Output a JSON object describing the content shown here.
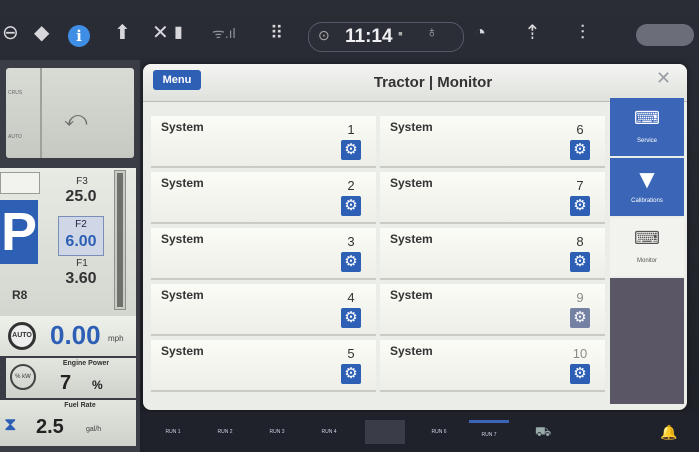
{
  "status_bar": {
    "time": "11:14",
    "info_icon": "i"
  },
  "left_panel": {
    "top_labels": [
      "CRUS",
      "AUTO"
    ],
    "gear_big": "P",
    "gears": [
      {
        "label": "F3",
        "value": "25.0"
      },
      {
        "label": "F2",
        "value": "6.00"
      },
      {
        "label": "F1",
        "value": "3.60"
      }
    ],
    "range_label": "R8",
    "auto_label": "AUTO",
    "speed_value": "0.00",
    "speed_unit": "mph",
    "engine_power_label": "Engine Power",
    "engine_power_icon_label": "% kW",
    "engine_power_value": "7",
    "engine_power_unit": "%",
    "fuel_rate_label": "Fuel Rate",
    "fuel_rate_value": "2.5",
    "fuel_rate_unit": "gal/h"
  },
  "dialog": {
    "menu_label": "Menu",
    "title": "Tractor | Monitor",
    "close_icon": "close-icon",
    "systems": [
      {
        "label": "System",
        "number": "1"
      },
      {
        "label": "System",
        "number": "2"
      },
      {
        "label": "System",
        "number": "3"
      },
      {
        "label": "System",
        "number": "4"
      },
      {
        "label": "System",
        "number": "5"
      },
      {
        "label": "System",
        "number": "6"
      },
      {
        "label": "System",
        "number": "7"
      },
      {
        "label": "System",
        "number": "8"
      },
      {
        "label": "System",
        "number": "9"
      },
      {
        "label": "System",
        "number": "10"
      }
    ]
  },
  "right_sidebar": {
    "items": [
      {
        "label": "Service"
      },
      {
        "label": "Calibrations"
      },
      {
        "label": "Monitor"
      }
    ]
  },
  "run_bar": {
    "items": [
      "RUN 1",
      "RUN 2",
      "RUN 3",
      "RUN 4",
      "",
      "RUN 6",
      "RUN 7"
    ]
  },
  "colors": {
    "accent": "#2d5fb5",
    "dialog_bg": "#ebeee8"
  }
}
